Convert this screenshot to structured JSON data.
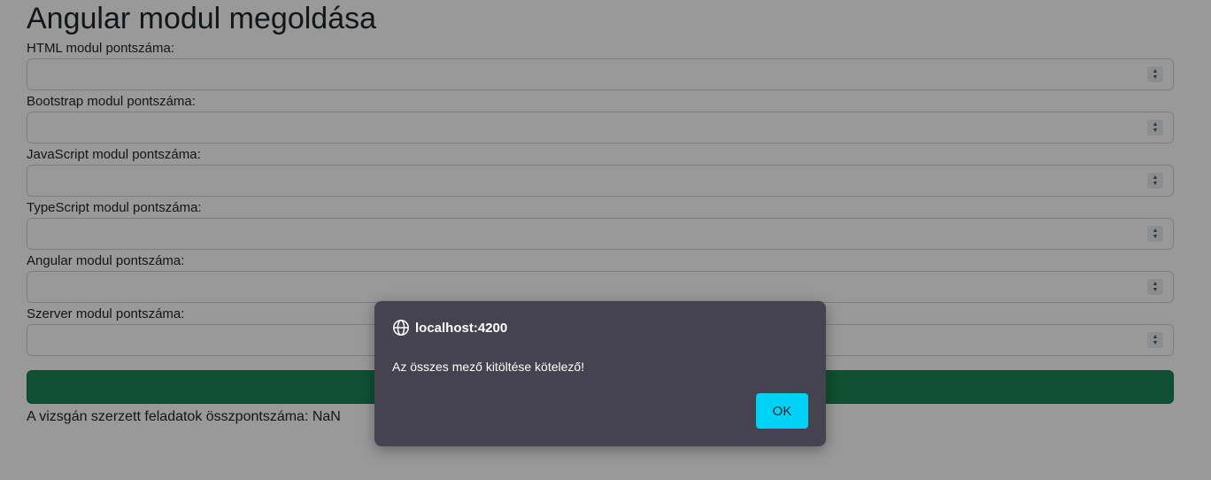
{
  "page": {
    "title": "Angular modul megoldása",
    "fields": [
      {
        "label": "HTML modul pontszáma:",
        "value": ""
      },
      {
        "label": "Bootstrap modul pontszáma:",
        "value": ""
      },
      {
        "label": "JavaScript modul pontszáma:",
        "value": ""
      },
      {
        "label": "TypeScript modul pontszáma:",
        "value": ""
      },
      {
        "label": "Angular modul pontszáma:",
        "value": ""
      },
      {
        "label": "Szerver modul pontszáma:",
        "value": ""
      }
    ],
    "submit_label": "",
    "result_text": "A vizsgán szerzett feladatok összpontszáma: NaN"
  },
  "dialog": {
    "host": "localhost:4200",
    "message": "Az összes mező kitöltése kötelező!",
    "ok_label": "OK",
    "host_icon": "globe-icon"
  },
  "colors": {
    "submit": "#198754",
    "dialog_bg": "#45434f",
    "ok_button": "#00d2f5"
  }
}
